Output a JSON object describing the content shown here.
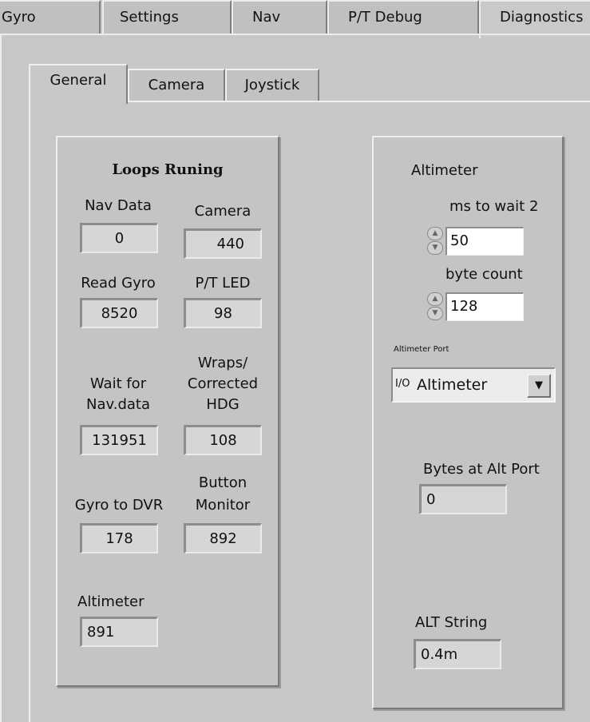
{
  "outer_tabs": [
    "Gyro",
    "Settings",
    "Nav",
    "P/T Debug",
    "Diagnostics"
  ],
  "active_outer_tab": "Diagnostics",
  "inner_tabs": [
    "General",
    "Camera",
    "Joystick"
  ],
  "active_inner_tab": "General",
  "loops": {
    "title": "Loops Runing",
    "nav_data_label": "Nav Data",
    "nav_data_value": "0",
    "camera_label": "Camera",
    "camera_value": "440",
    "read_gyro_label": "Read Gyro",
    "read_gyro_value": "8520",
    "pt_led_label": "P/T LED",
    "pt_led_value": "98",
    "wait_nav_label_1": "Wait for",
    "wait_nav_label_2": "Nav.data",
    "wait_nav_value": "131951",
    "wraps_label_1": "Wraps/",
    "wraps_label_2": "Corrected",
    "wraps_label_3": "HDG",
    "wraps_value": "108",
    "gyro_dvr_label": "Gyro to DVR",
    "gyro_dvr_value": "178",
    "button_monitor_label_1": "Button",
    "button_monitor_label_2": "Monitor",
    "button_monitor_value": "892",
    "altimeter_label": "Altimeter",
    "altimeter_value": "891"
  },
  "altimeter": {
    "title": "Altimeter",
    "ms_wait_label": "ms to wait 2",
    "ms_wait_value": "50",
    "byte_count_label": "byte count",
    "byte_count_value": "128",
    "port_label": "Altimeter Port",
    "port_io_glyph": "I/O",
    "port_value": "Altimeter",
    "bytes_at_port_label": "Bytes at Alt Port",
    "bytes_at_port_value": "0",
    "alt_string_label": "ALT String",
    "alt_string_value": "0.4m"
  }
}
